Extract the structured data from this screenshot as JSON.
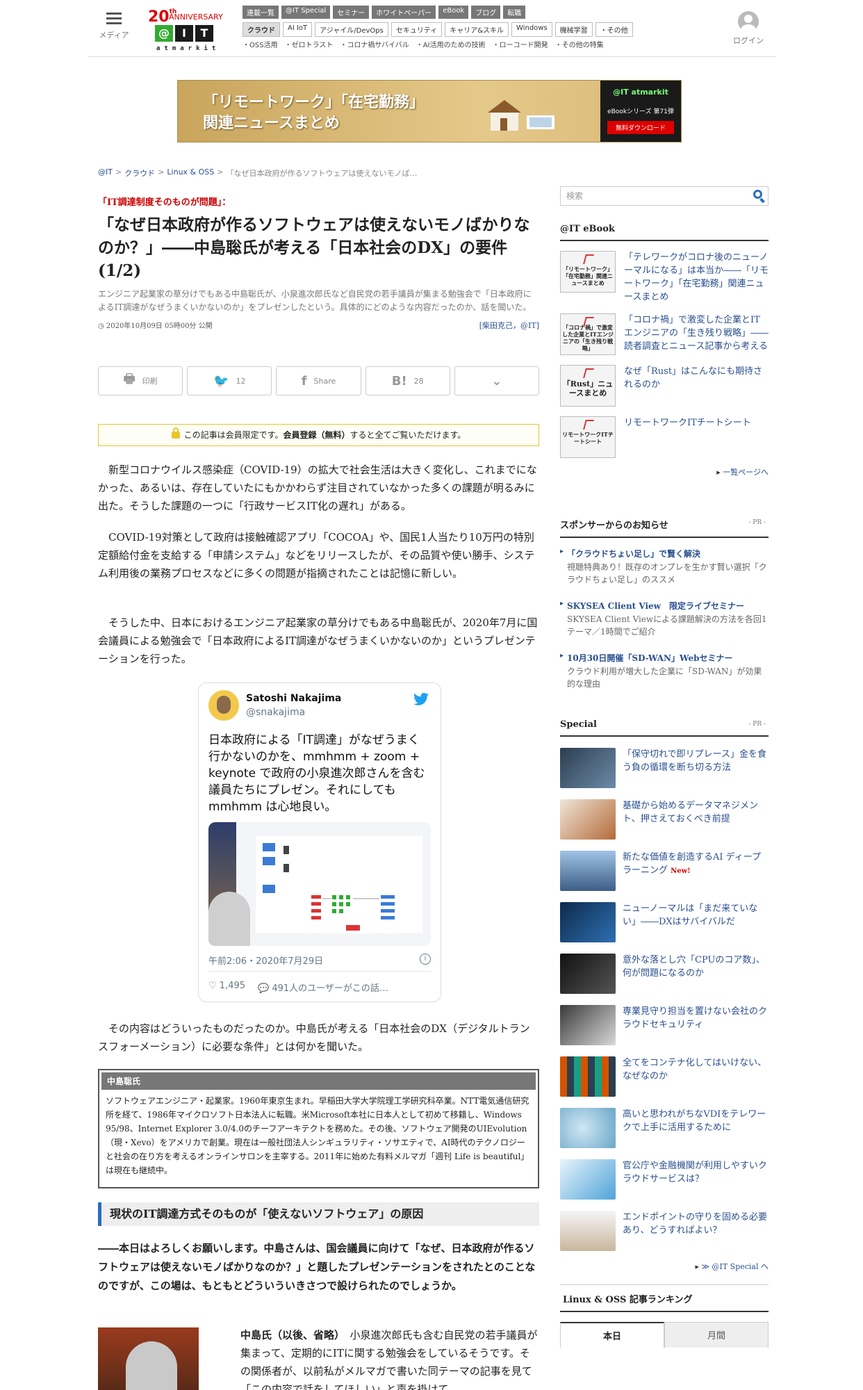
{
  "header": {
    "menu_label": "メディア",
    "logo_anniv_num": "20",
    "logo_anniv_th": "th",
    "logo_anniv_text": "ANNIVERSARY",
    "logo_at": "@",
    "logo_i": "I",
    "logo_t": "T",
    "logo_sub": "atmarkit",
    "nav_primary": [
      "連載一覧",
      "@IT Special",
      "セミナー",
      "ホワイトペーパー",
      "eBook",
      "ブログ",
      "転職"
    ],
    "nav_secondary": [
      "クラウド",
      "AI IoT",
      "アジャイル/DevOps",
      "セキュリティ",
      "キャリア&スキル",
      "Windows",
      "機械学習",
      "・その他"
    ],
    "nav_tertiary": [
      "・OSS活用",
      "・ゼロトラスト",
      "・コロナ禍サバイバル",
      "・AI活用のための技術",
      "・ローコード開発",
      "・その他の特集"
    ],
    "login_label": "ログイン"
  },
  "banner": {
    "line1": "「リモートワーク」「在宅勤務」",
    "line2": "関連ニュースまとめ",
    "logo": "@IT atmarkit",
    "series": "eBookシリーズ 第71弾",
    "cta": "無料ダウンロード"
  },
  "breadcrumb": [
    "@IT",
    "クラウド",
    "Linux & OSS",
    "「なぜ日本政府が作るソフトウェアは使えないモノば…"
  ],
  "breadcrumb_sep": ">",
  "article": {
    "kicker": "「IT調達制度そのものが問題」：",
    "title": "「なぜ日本政府が作るソフトウェアは使えないモノばかりなのか？」――中島聡氏が考える「日本社会のDX」の要件 (1/2)",
    "lead": "エンジニア起業家の草分けでもある中島聡氏が、小泉進次郎氏など自民党の若手議員が集まる勉強会で「日本政府によるIT調達がなぜうまくいかないのか」をプレゼンしたという。具体的にどのような内容だったのか、話を聞いた。",
    "date": "2020年10月09日 05時00分 公開",
    "author": "[柴田克己，@IT]",
    "share": [
      {
        "icon": "print-icon",
        "glyph": "🖶",
        "label": "印刷"
      },
      {
        "icon": "twitter-icon",
        "glyph": "🐦",
        "label": "12"
      },
      {
        "icon": "facebook-icon",
        "glyph": "f",
        "label": "Share"
      },
      {
        "icon": "hatena-icon",
        "glyph": "B!",
        "label": "28"
      },
      {
        "icon": "pocket-icon",
        "glyph": "⌄",
        "label": ""
      }
    ],
    "members_notice_pre": "この記事は会員限定です。",
    "members_notice_link": "会員登録（無料）",
    "members_notice_post": "すると全てご覧いただけます。",
    "p1": "新型コロナウイルス感染症（COVID-19）の拡大で社会生活は大きく変化し、これまでになかった、あるいは、存在していたにもかかわらず注目されていなかった多くの課題が明るみに出た。そうした課題の一つに「行政サービスIT化の遅れ」がある。",
    "p2": "COVID-19対策として政府は接触確認アプリ「COCOA」や、国民1人当たり10万円の特別定額給付金を支給する「申請システム」などをリリースしたが、その品質や使い勝手、システム利用後の業務プロセスなどに多くの問題が指摘されたことは記憶に新しい。",
    "p3": "そうした中、日本におけるエンジニア起業家の草分けでもある中島聡氏が、2020年7月に国会議員による勉強会で「日本政府によるIT調達がなぜうまくいかないのか」というプレゼンテーションを行った。",
    "p4": "その内容はどういったものだったのか。中島氏が考える「日本社会のDX（デジタルトランスフォーメーション）に必要な条件」とは何かを聞いた。"
  },
  "tweet": {
    "name": "Satoshi Nakajima",
    "handle": "@snakajima",
    "text": "日本政府による「IT調達」がなぜうまく行かないのかを、mmhmm + zoom + keynote で政府の小泉進次郎さんを含む議員たちにプレゼン。それにしても mmhmm は心地良い。",
    "time": "午前2:06・2020年7月29日",
    "likes": "1,495",
    "replies": "491人のユーザーがこの話…"
  },
  "profile": {
    "name": "中島聡氏",
    "bio": "ソフトウェアエンジニア・起業家。1960年東京生まれ。早稲田大学大学院理工学研究科卒業。NTT電気通信研究所を経て、1986年マイクロソフト日本法人に転職。米Microsoft本社に日本人として初めて移籍し、Windows 95/98、Internet Explorer 3.0/4.0のチーフアーキテクトを務めた。その後、ソフトウェア開発のUIEvolution（現・Xevo）をアメリカで創業。現在は一般社団法人シンギュラリティ・ソサエティで、AI時代のテクノロジーと社会の在り方を考えるオンラインサロンを主宰する。2011年に始めた有料メルマガ「週刊 Life is beautiful」は現在も継続中。"
  },
  "section": {
    "heading": "現状のIT調達方式そのものが「使えないソフトウェア」の原因",
    "question": "――本日はよろしくお願いします。中島さんは、国会議員に向けて「なぜ、日本政府が作るソフトウェアは使えないモノばかりなのか？」と題したプレゼンテーションをされたとのことなのですが、この場は、もともとどういういきさつで設けられたのでしょうか。",
    "answer_lead": "中島氏（以後、省略）",
    "answer": "小泉進次郎氏も含む自民党の若手議員が集まって、定期的にITに関する勉強会をしているそうです。その関係者が、以前私がメルマガで書いた同テーマの記事を見て「この内容で話をしてほしい」と声を掛けて"
  },
  "sidebar": {
    "search_placeholder": "検索",
    "ebook_heading": "@IT eBook",
    "ebooks": [
      {
        "cover": "「リモートワーク」「在宅勤務」関連ニュースまとめ",
        "title": "「テレワークがコロナ後のニューノーマルになる」は本当か――「リモートワーク」「在宅勤務」関連ニュースまとめ"
      },
      {
        "cover": "「コロナ禍」で激変した企業とITエンジニアの「生き残り戦略」",
        "title": "「コロナ禍」で激変した企業とITエンジニアの「生き残り戦略」――読者調査とニュース記事から考える"
      },
      {
        "cover": "「Rust」ニュースまとめ",
        "title": "なぜ「Rust」はこんなにも期待されるのか"
      },
      {
        "cover": "リモートワークITチートシート",
        "title": "リモートワークITチートシート"
      }
    ],
    "ebook_more": "一覧ページへ",
    "sponsor_heading": "スポンサーからのお知らせ",
    "pr_label": "- PR -",
    "sponsors": [
      {
        "title": "「クラウドちょい足し」で賢く解決",
        "desc": "視聴特典あり！既存のオンプレを生かす賢い選択「クラウドちょい足し」のススメ"
      },
      {
        "title": "SKYSEA Client View　限定ライブセミナー",
        "desc": "SKYSEA Client Viewによる課題解決の方法を各回1テーマ／1時間でご紹介"
      },
      {
        "title": "10月30日開催「SD-WAN」Webセミナー",
        "desc": "クラウド利用が増大した企業に「SD-WAN」が効果的な理由"
      }
    ],
    "special_heading": "Special",
    "specials": [
      {
        "title": "「保守切れで即リプレース」金を食う負の循環を断ち切る方法",
        "new": ""
      },
      {
        "title": "基礎から始めるデータマネジメント、押さえておくべき前提",
        "new": ""
      },
      {
        "title": "新たな価値を創造するAI ディープラーニング",
        "new": "New!"
      },
      {
        "title": "ニューノーマルは「まだ来ていない」――DXはサバイバルだ",
        "new": ""
      },
      {
        "title": "意外な落とし穴「CPUのコア数」、何が問題になるのか",
        "new": ""
      },
      {
        "title": "専業見守り担当を置けない会社のクラウドセキュリティ",
        "new": ""
      },
      {
        "title": "全てをコンテナ化してはいけない、なぜなのか",
        "new": ""
      },
      {
        "title": "高いと思われがちなVDIをテレワークで上手に活用するために",
        "new": ""
      },
      {
        "title": "官公庁や金融機関が利用しやすいクラウドサービスは？",
        "new": ""
      },
      {
        "title": "エンドポイントの守りを固める必要あり、どうすればよい？",
        "new": ""
      }
    ],
    "special_more": "≫ @IT Special へ",
    "ranking_heading": "Linux & OSS 記事ランキング",
    "ranking_tabs": [
      "本日",
      "月間"
    ]
  }
}
